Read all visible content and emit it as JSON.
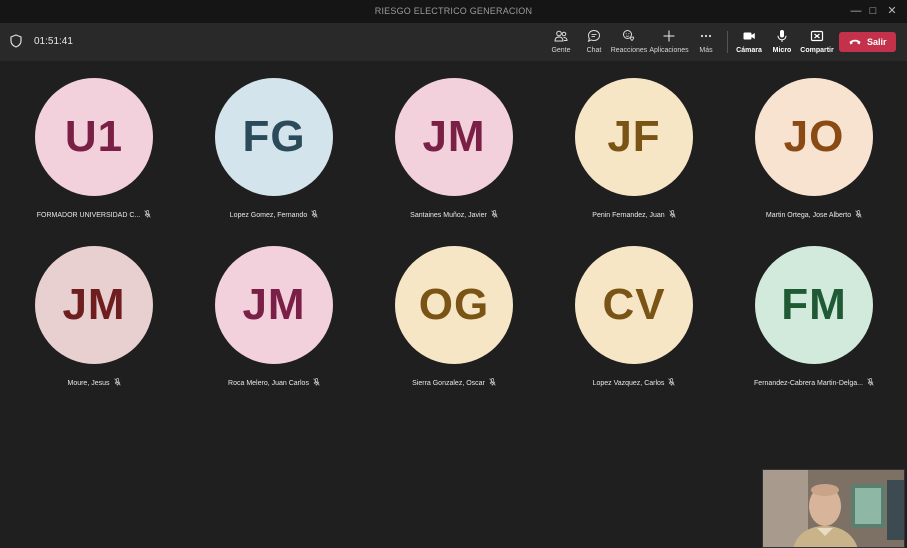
{
  "window": {
    "title": "RIESGO ELECTRICO GENERACION"
  },
  "meeting": {
    "elapsed_time": "01:51:41"
  },
  "toolbar": {
    "buttons": [
      {
        "label": "Gente",
        "icon": "people-icon"
      },
      {
        "label": "Chat",
        "icon": "chat-icon"
      },
      {
        "label": "Reacciones",
        "icon": "reactions-icon"
      },
      {
        "label": "Aplicaciones",
        "icon": "add-apps-icon"
      },
      {
        "label": "Más",
        "icon": "more-icon"
      },
      {
        "label": "Cámara",
        "icon": "camera-icon"
      },
      {
        "label": "Micro",
        "icon": "microphone-icon"
      },
      {
        "label": "Compartir",
        "icon": "share-screen-icon"
      }
    ],
    "leave_label": "Salir"
  },
  "participants": [
    {
      "initials": "U1",
      "name": "FORMADOR UNIVERSIDAD C...",
      "bg": "#f2d0dc",
      "fg": "#7a1f45"
    },
    {
      "initials": "FG",
      "name": "Lopez Gomez, Fernando",
      "bg": "#d4e4ec",
      "fg": "#2b4b5a"
    },
    {
      "initials": "JM",
      "name": "Santaines Muñoz, Javier",
      "bg": "#f2d0dc",
      "fg": "#7a1f45"
    },
    {
      "initials": "JF",
      "name": "Penin Fernandez, Juan",
      "bg": "#f6e6c6",
      "fg": "#7a5414"
    },
    {
      "initials": "JO",
      "name": "Martin Ortega, Jose Alberto",
      "bg": "#f8e3d1",
      "fg": "#8a4a14"
    },
    {
      "initials": "JM",
      "name": "Moure, Jesus",
      "bg": "#e9d0d0",
      "fg": "#6e1e1e"
    },
    {
      "initials": "JM",
      "name": "Roca Melero, Juan Carlos",
      "bg": "#f2d0dc",
      "fg": "#7a1f45"
    },
    {
      "initials": "OG",
      "name": "Sierra Gonzalez, Oscar",
      "bg": "#f6e6c6",
      "fg": "#7a5414"
    },
    {
      "initials": "CV",
      "name": "Lopez Vazquez, Carlos",
      "bg": "#f6e6c6",
      "fg": "#7a5414"
    },
    {
      "initials": "FM",
      "name": "Fernandez-Cabrera Martin-Delga...",
      "bg": "#d2eadc",
      "fg": "#1f5a34"
    }
  ],
  "colors": {
    "leave_button": "#c4314b",
    "toolbar_bg": "#292929",
    "stage_bg": "#1f1f1f"
  }
}
